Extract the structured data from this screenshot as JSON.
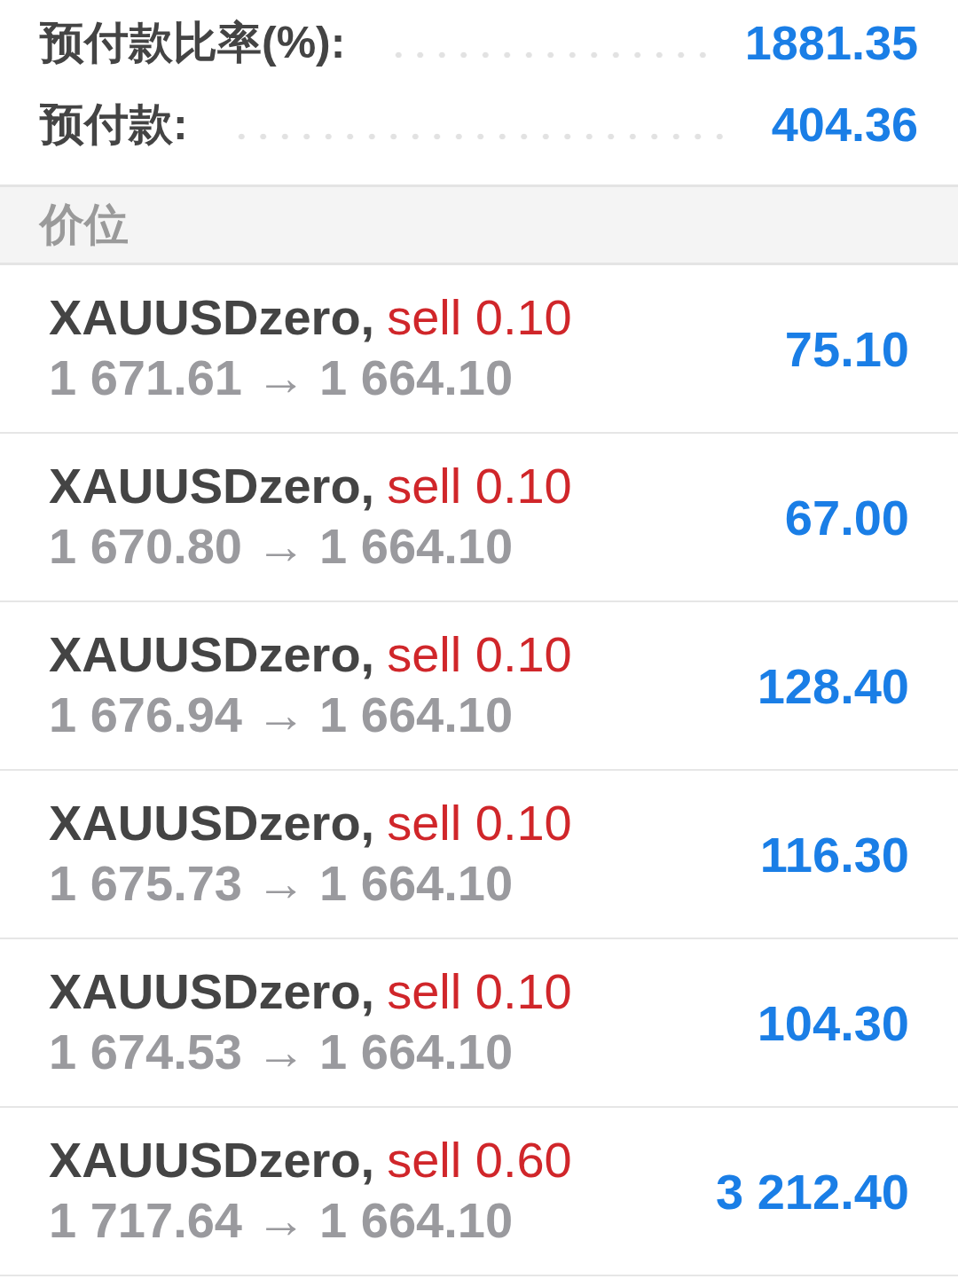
{
  "summary": [
    {
      "label": "预付款比率(%):",
      "value": "1881.35"
    },
    {
      "label": "预付款:",
      "value": "404.36"
    }
  ],
  "section": {
    "title": "价位"
  },
  "positions": [
    {
      "symbol": "XAUUSDzero,",
      "side": "sell 0.10",
      "prices": "1 671.61 → 1 664.10",
      "profit": "75.10"
    },
    {
      "symbol": "XAUUSDzero,",
      "side": "sell 0.10",
      "prices": "1 670.80 → 1 664.10",
      "profit": "67.00"
    },
    {
      "symbol": "XAUUSDzero,",
      "side": "sell 0.10",
      "prices": "1 676.94 → 1 664.10",
      "profit": "128.40"
    },
    {
      "symbol": "XAUUSDzero,",
      "side": "sell 0.10",
      "prices": "1 675.73 → 1 664.10",
      "profit": "116.30"
    },
    {
      "symbol": "XAUUSDzero,",
      "side": "sell 0.10",
      "prices": "1 674.53 → 1 664.10",
      "profit": "104.30"
    },
    {
      "symbol": "XAUUSDzero,",
      "side": "sell 0.60",
      "prices": "1 717.64 → 1 664.10",
      "profit": "3 212.40"
    }
  ]
}
